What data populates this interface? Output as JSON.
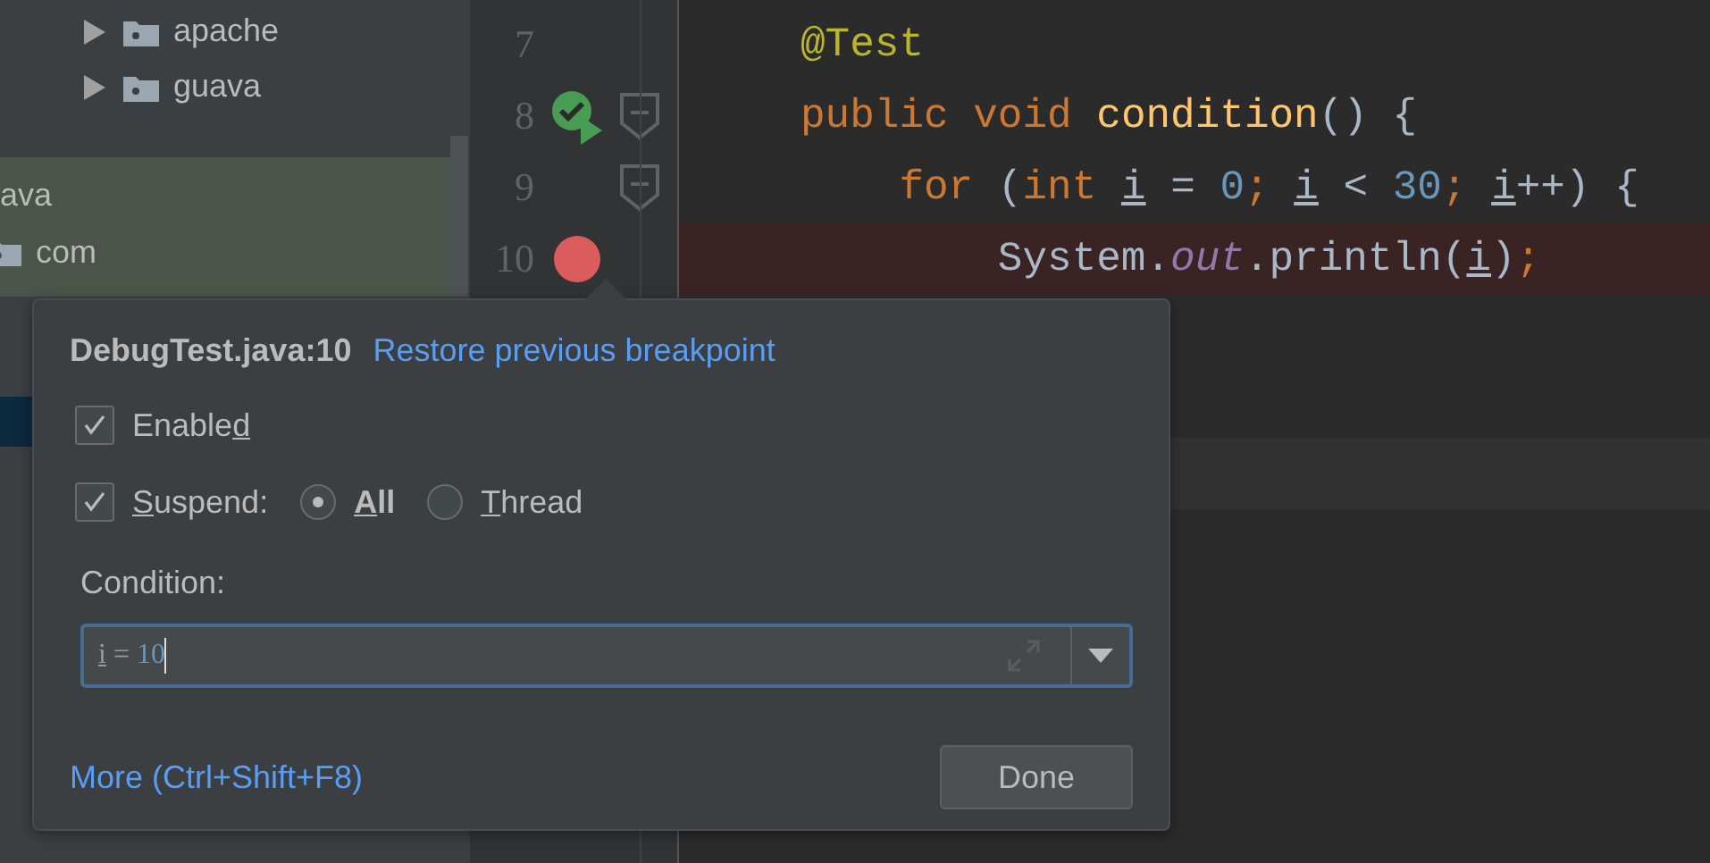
{
  "project_tree": {
    "packages": [
      {
        "label": "apache",
        "expanded": false
      },
      {
        "label": "guava",
        "expanded": false
      }
    ],
    "test_root": {
      "label": "ava",
      "children": [
        {
          "label": "com"
        }
      ]
    }
  },
  "editor": {
    "lines": [
      {
        "number": "7",
        "run_icon": false,
        "breakpoint": false,
        "fold": false,
        "highlighted": false,
        "tokens": [
          {
            "kind": "annotation",
            "text": "@Test"
          }
        ]
      },
      {
        "number": "8",
        "run_icon": true,
        "breakpoint": false,
        "fold": true,
        "highlighted": false,
        "tokens": [
          {
            "kind": "keyword",
            "text": "public void "
          },
          {
            "kind": "method",
            "text": "condition"
          },
          {
            "kind": "plain",
            "text": "() {"
          }
        ]
      },
      {
        "number": "9",
        "run_icon": false,
        "breakpoint": false,
        "fold": true,
        "highlighted": false,
        "tokens": [
          {
            "kind": "keyword",
            "text": "for "
          },
          {
            "kind": "plain",
            "text": "("
          },
          {
            "kind": "keyword",
            "text": "int "
          },
          {
            "kind": "var",
            "text": "i"
          },
          {
            "kind": "plain",
            "text": " = "
          },
          {
            "kind": "number",
            "text": "0"
          },
          {
            "kind": "keyword",
            "text": "; "
          },
          {
            "kind": "var",
            "text": "i"
          },
          {
            "kind": "plain",
            "text": " < "
          },
          {
            "kind": "number",
            "text": "30"
          },
          {
            "kind": "keyword",
            "text": "; "
          },
          {
            "kind": "var",
            "text": "i"
          },
          {
            "kind": "plain",
            "text": "++) {"
          }
        ]
      },
      {
        "number": "10",
        "run_icon": false,
        "breakpoint": true,
        "fold": false,
        "highlighted": true,
        "tokens": [
          {
            "kind": "plain",
            "text": "System."
          },
          {
            "kind": "field",
            "text": "out"
          },
          {
            "kind": "plain",
            "text": ".println("
          },
          {
            "kind": "var",
            "text": "i"
          },
          {
            "kind": "plain",
            "text": ")"
          },
          {
            "kind": "keyword",
            "text": ";"
          }
        ]
      }
    ]
  },
  "breakpoint_popup": {
    "title": "DebugTest.java:10",
    "restore_link": "Restore previous breakpoint",
    "enabled": {
      "checked": true,
      "label": [
        {
          "text": "Enable",
          "underline": false
        },
        {
          "text": "d",
          "underline": true
        }
      ]
    },
    "suspend": {
      "checked": true,
      "label": [
        {
          "text": "S",
          "underline": true
        },
        {
          "text": "uspend:",
          "underline": false
        }
      ],
      "options": [
        {
          "selected": true,
          "label": [
            {
              "text": "A",
              "underline": true
            },
            {
              "text": "ll",
              "underline": false
            }
          ]
        },
        {
          "selected": false,
          "label": [
            {
              "text": "T",
              "underline": true
            },
            {
              "text": "hread",
              "underline": false
            }
          ]
        }
      ]
    },
    "condition": {
      "label": "Condition:",
      "tokens": [
        {
          "kind": "var",
          "text": "i"
        },
        {
          "kind": "plain",
          "text": " = "
        },
        {
          "kind": "number",
          "text": "10"
        }
      ]
    },
    "more_link": "More (Ctrl+Shift+F8)",
    "done_button": "Done"
  }
}
